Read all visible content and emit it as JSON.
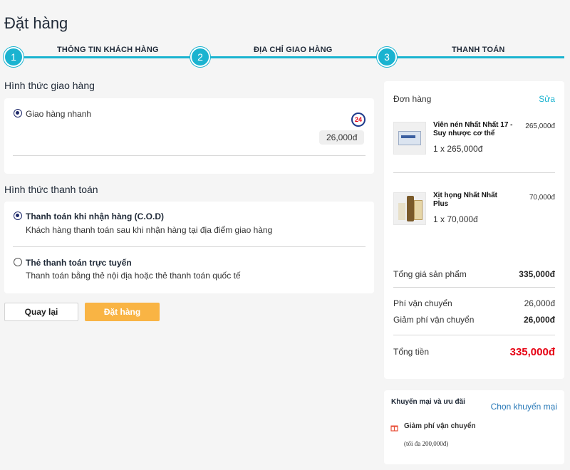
{
  "page": {
    "title": "Đặt hàng"
  },
  "stepper": {
    "steps": [
      {
        "number": "1",
        "label": "THÔNG TIN KHÁCH HÀNG"
      },
      {
        "number": "2",
        "label": "ĐỊA CHỈ GIAO HÀNG"
      },
      {
        "number": "3",
        "label": "THANH TOÁN"
      }
    ]
  },
  "shipping": {
    "section_title": "Hình thức giao hàng",
    "option_label": "Giao hàng nhanh",
    "carrier_badge": "24",
    "price": "26,000đ"
  },
  "payment": {
    "section_title": "Hình thức thanh toán",
    "options": [
      {
        "title": "Thanh toán khi nhận hàng (C.O.D)",
        "description": "Khách hàng thanh toán sau khi nhận hàng tại địa điểm giao hàng",
        "selected": true
      },
      {
        "title": "Thẻ thanh toán trực tuyến",
        "description": "Thanh toán bằng thẻ nội địa hoặc thẻ thanh toán quốc tế",
        "selected": false
      }
    ]
  },
  "actions": {
    "back_label": "Quay lại",
    "order_label": "Đặt hàng"
  },
  "order": {
    "title": "Đơn hàng",
    "edit_label": "Sửa",
    "items": [
      {
        "name": "Viên nén Nhất Nhất 17 - Suy nhược cơ thể",
        "qty_price": "1 x 265,000đ",
        "total": "265,000đ"
      },
      {
        "name": "Xịt họng Nhất Nhất Plus",
        "qty_price": "1 x 70,000đ",
        "total": "70,000đ"
      }
    ],
    "subtotal_label": "Tổng giá sản phẩm",
    "subtotal_value": "335,000đ",
    "shipping_label": "Phí vận chuyển",
    "shipping_value": "26,000đ",
    "shipping_discount_label": "Giảm phí vận chuyển",
    "shipping_discount_value": "26,000đ",
    "total_label": "Tổng tiền",
    "total_value": "335,000đ"
  },
  "promo": {
    "title": "Khuyến mại và ưu đãi",
    "choose_label": "Chọn khuyến mại",
    "item_title": "Giảm phí vận chuyển",
    "item_note": "(tối đa 200,000đ)"
  },
  "colors": {
    "accent": "#1ab3d0",
    "order_button": "#f9b444",
    "total_red": "#e60012",
    "link_blue": "#2a7ab8"
  }
}
